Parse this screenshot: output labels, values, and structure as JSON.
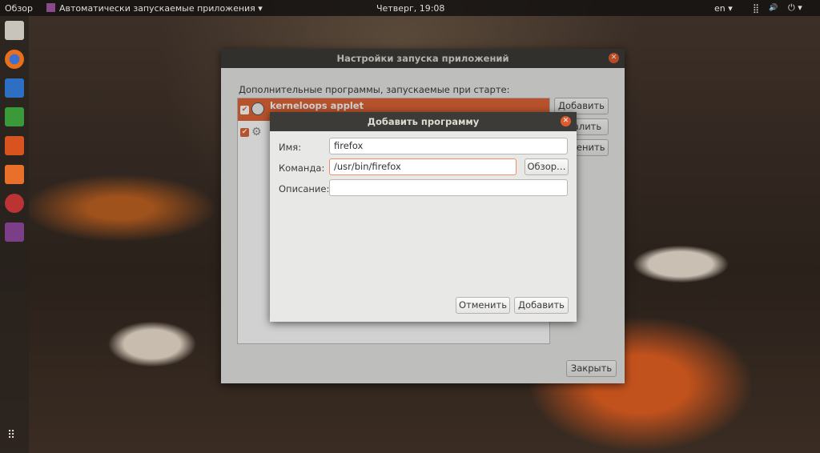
{
  "topbar": {
    "activities": "Обзор",
    "app_menu": "Автоматически запускаемые приложения ▾",
    "clock": "Четверг, 19:08",
    "lang": "en ▾",
    "network": "⣿",
    "volume": "🔊",
    "power": "⏻ ▾"
  },
  "parent": {
    "title": "Настройки запуска приложений",
    "list_label": "Дополнительные программы, запускаемые при старте:",
    "items": [
      {
        "name": "kerneloops applet",
        "checked": true
      },
      {
        "name": "",
        "checked": true
      }
    ],
    "add": "Добавить",
    "remove": "Удалить",
    "edit": "Изменить",
    "close": "Закрыть"
  },
  "dialog": {
    "title": "Добавить программу",
    "name_label": "Имя:",
    "name_value": "firefox",
    "command_label": "Команда:",
    "command_value": "/usr/bin/firefox",
    "browse": "Обзор…",
    "desc_label": "Описание:",
    "desc_value": "",
    "cancel": "Отменить",
    "add": "Добавить"
  },
  "accent": "#e06436"
}
